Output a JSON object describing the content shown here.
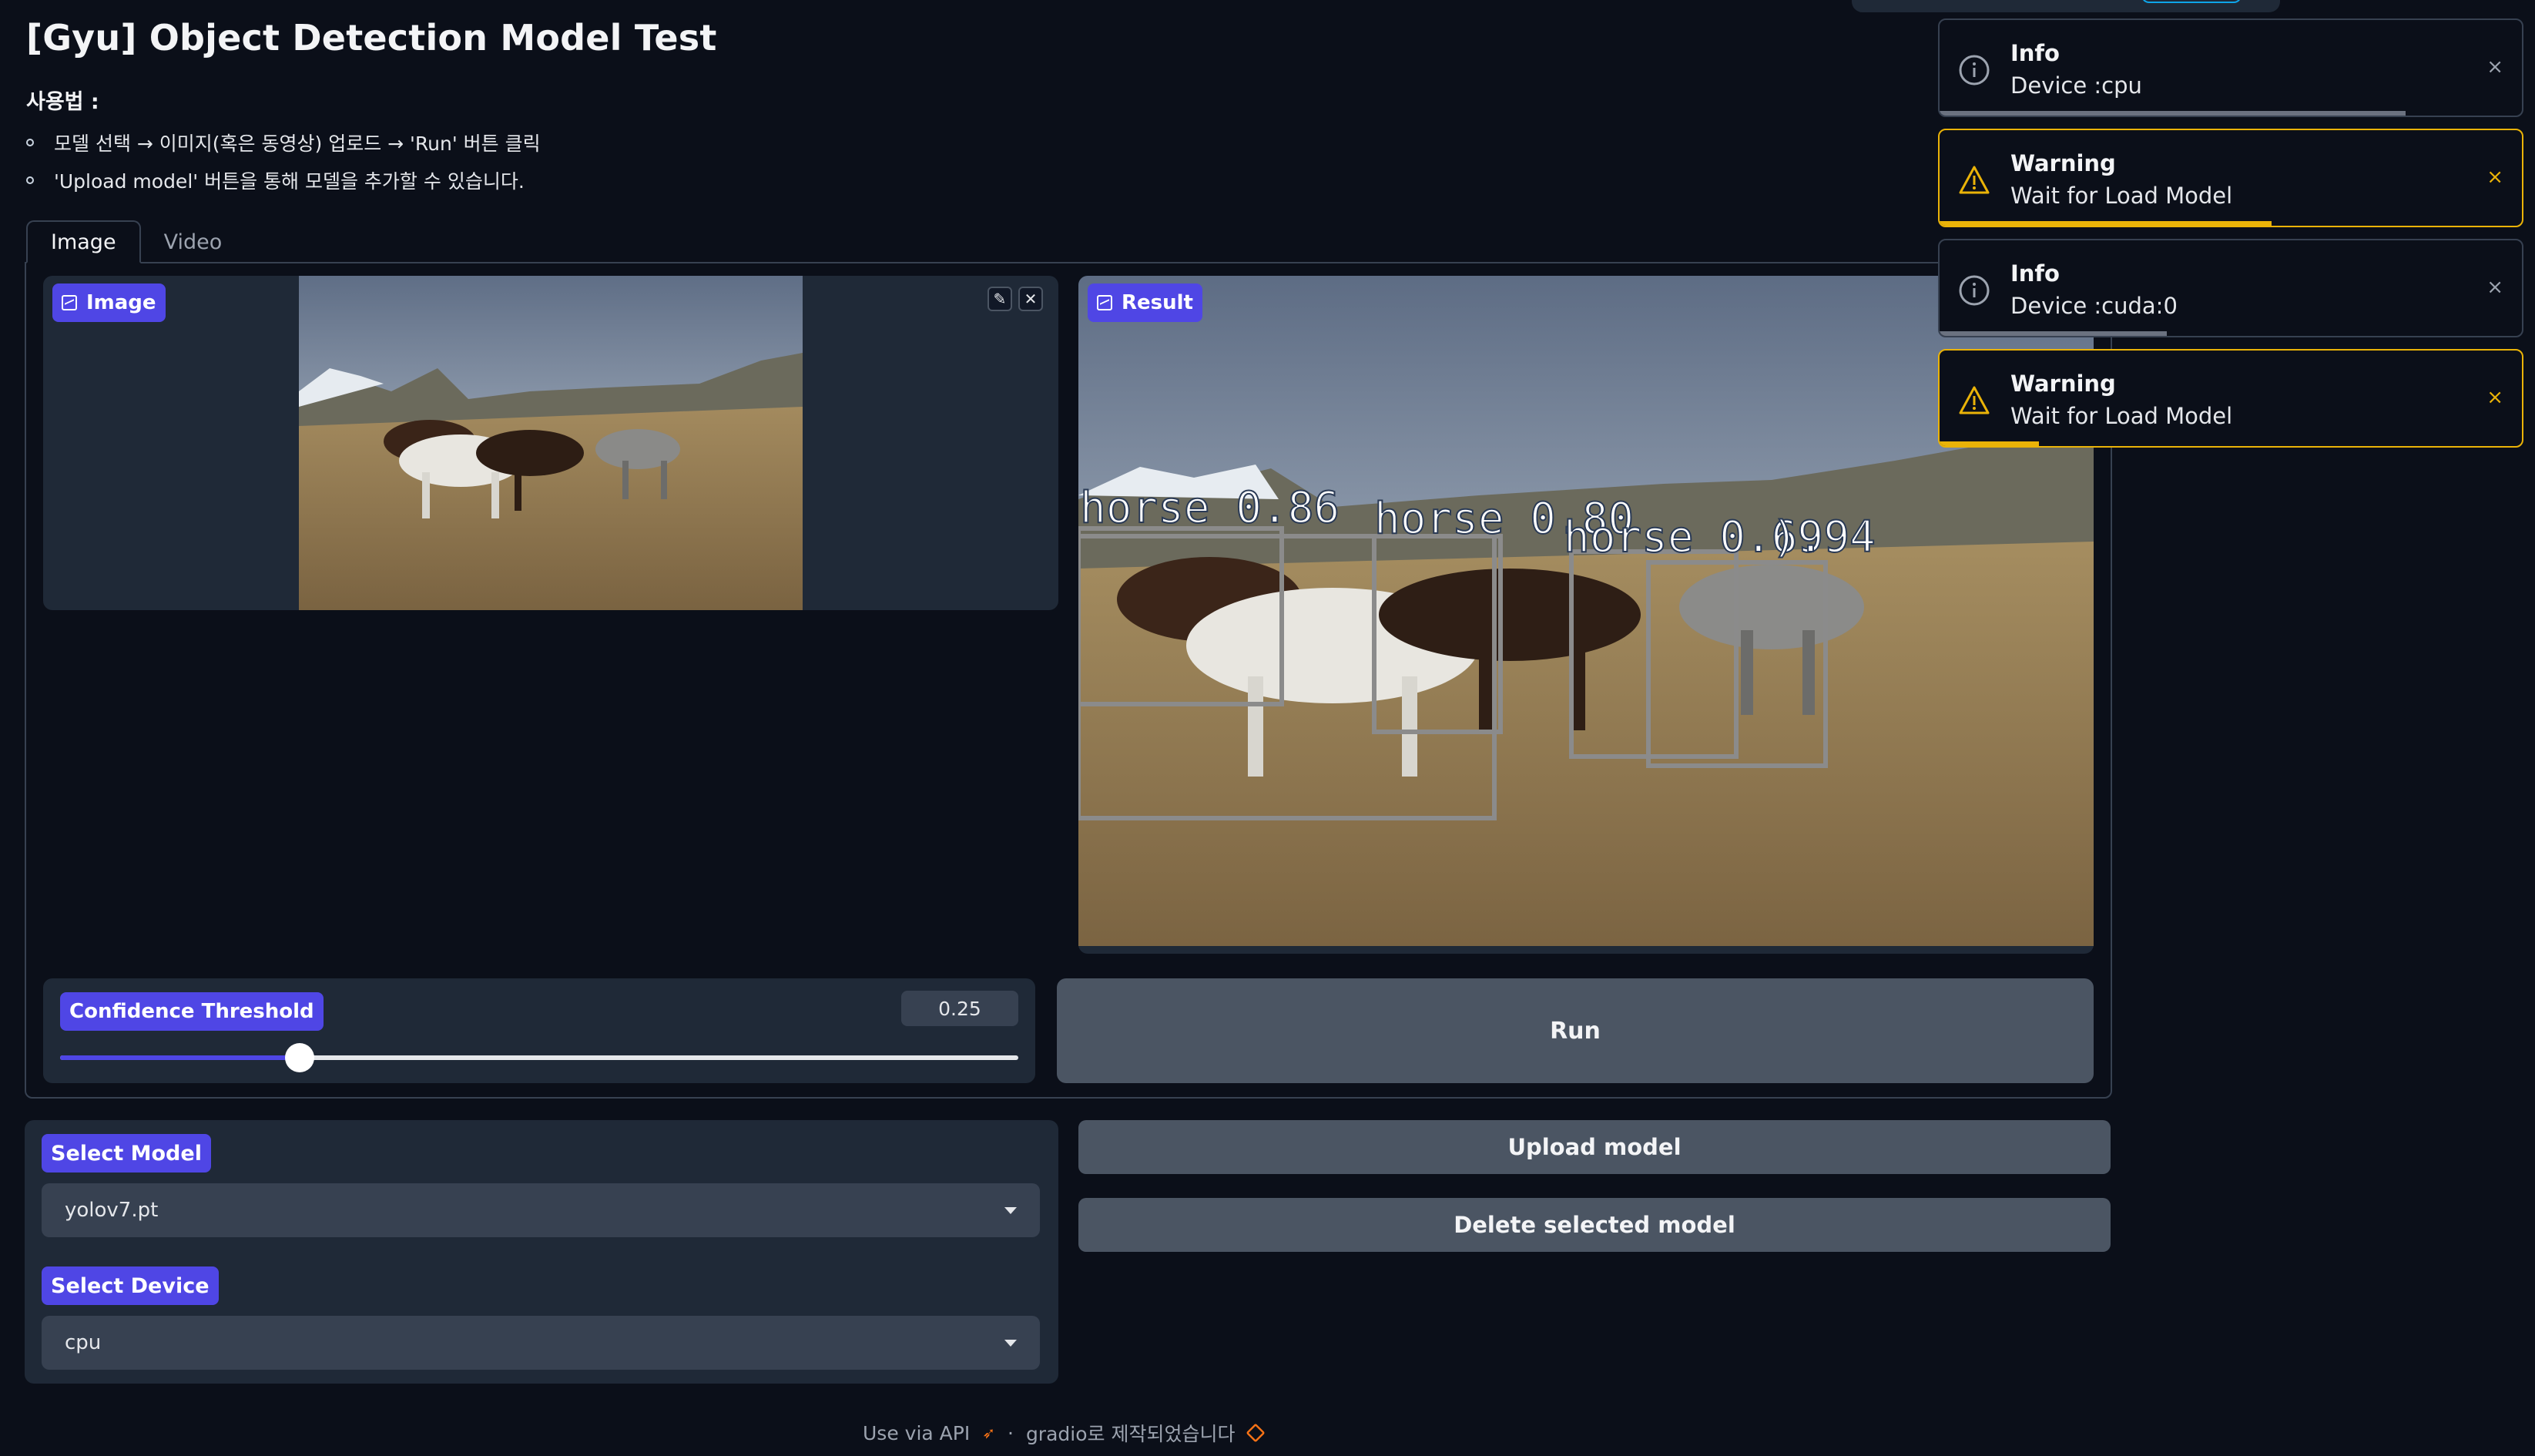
{
  "header": {
    "title": "[Gyu] Object Detection Model Test",
    "usage_label": "사용법 :",
    "usage_items": [
      "모델 선택 → 이미지(혹은 동영상) 업로드 → 'Run' 버튼 클릭",
      "'Upload model' 버튼을 통해 모델을 추가할 수 있습니다."
    ]
  },
  "tabs": [
    "Image",
    "Video"
  ],
  "active_tab": "Image",
  "image_input": {
    "label": "Image",
    "edit_icon": "pencil-icon",
    "clear_icon": "close-icon"
  },
  "result": {
    "label": "Result",
    "detections": [
      {
        "label": "horse",
        "score": "0.86"
      },
      {
        "label": "horse",
        "score": "0.80"
      },
      {
        "label": "horse",
        "score": "0.69"
      },
      {
        "label": "horse",
        "score": "0.94"
      }
    ],
    "detection_texts": [
      "horse  0.86",
      "horse  0.80",
      "horse  0.69",
      ").94"
    ]
  },
  "slider": {
    "label": "Confidence Threshold",
    "value": "0.25",
    "fraction": 0.25
  },
  "run_button": "Run",
  "model_select": {
    "label": "Select Model",
    "value": "yolov7.pt"
  },
  "device_select": {
    "label": "Select Device",
    "value": "cpu"
  },
  "upload_button": "Upload model",
  "delete_button": "Delete selected model",
  "footer": {
    "api": "Use via API",
    "sep": "·",
    "built": "gradio로 제작되었습니다"
  },
  "toasts": [
    {
      "type": "info",
      "title": "Info",
      "message": "Device :cpu",
      "progress": 0.8,
      "close": "×"
    },
    {
      "type": "warning",
      "title": "Warning",
      "message": "Wait for Load Model",
      "progress": 0.57,
      "close": "×"
    },
    {
      "type": "info",
      "title": "Info",
      "message": "Device :cuda:0",
      "progress": 0.39,
      "close": "×"
    },
    {
      "type": "warning",
      "title": "Warning",
      "message": "Wait for Load Model",
      "progress": 0.17,
      "close": "×"
    }
  ],
  "colors": {
    "background": "#0b0f19",
    "panel": "#1f2937",
    "accent": "#4f46e5",
    "warning": "#eab308",
    "button": "#4b5563"
  }
}
